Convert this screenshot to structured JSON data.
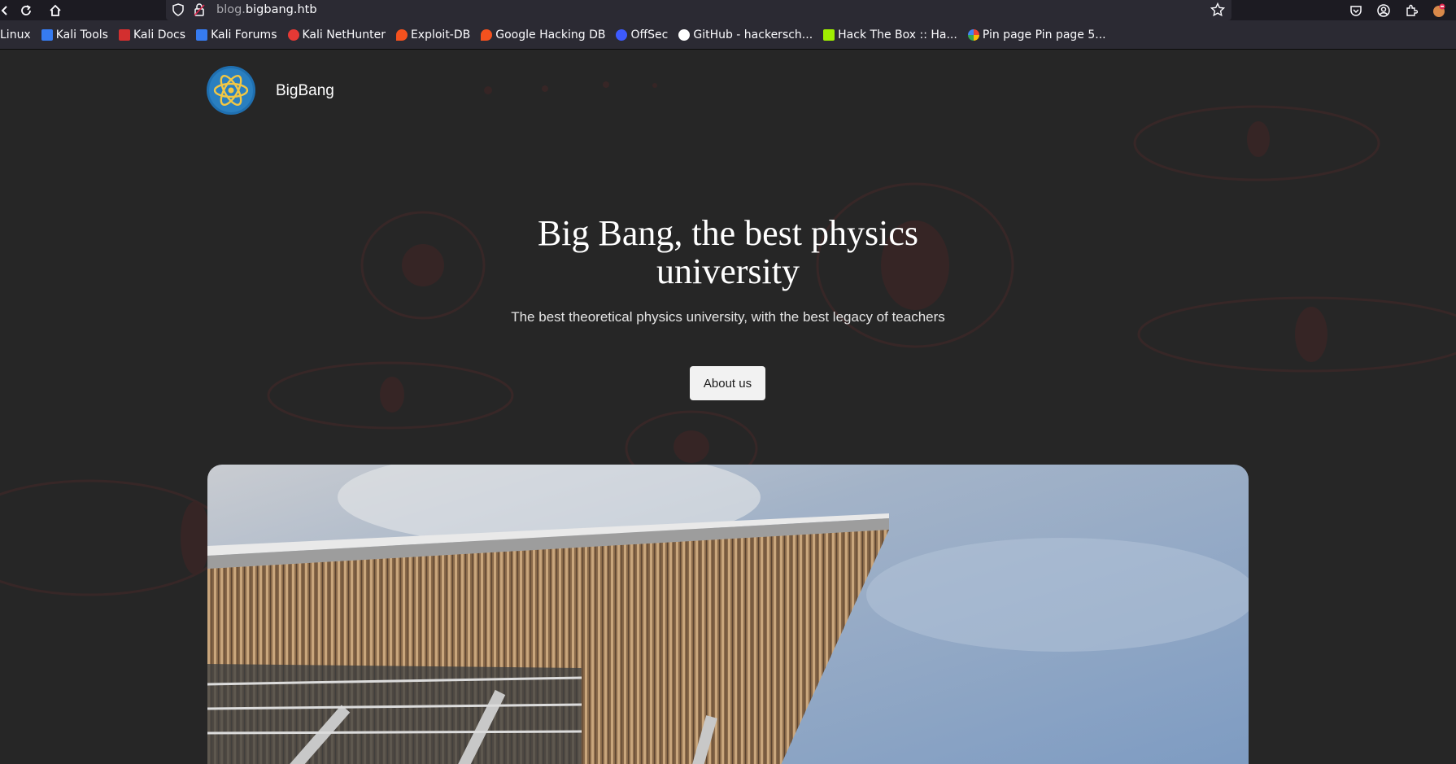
{
  "browser": {
    "url_subdomain": "blog.",
    "url_domain": "bigbang.htb",
    "bookmarks": [
      {
        "label": "Linux",
        "icon": "none"
      },
      {
        "label": "Kali Tools",
        "icon": "kali-tools-icon",
        "color": "#367bf0"
      },
      {
        "label": "Kali Docs",
        "icon": "kali-docs-icon",
        "color": "#d32f2f"
      },
      {
        "label": "Kali Forums",
        "icon": "kali-forums-icon",
        "color": "#367bf0"
      },
      {
        "label": "Kali NetHunter",
        "icon": "kali-nethunter-icon",
        "color": "#e53935"
      },
      {
        "label": "Exploit-DB",
        "icon": "exploit-db-icon",
        "color": "#f4511e"
      },
      {
        "label": "Google Hacking DB",
        "icon": "ghdb-icon",
        "color": "#f4511e"
      },
      {
        "label": "OffSec",
        "icon": "offsec-icon",
        "color": "#3d5afe"
      },
      {
        "label": "GitHub - hackersch...",
        "icon": "github-icon",
        "color": "#ffffff"
      },
      {
        "label": "Hack The Box :: Ha...",
        "icon": "htb-icon",
        "color": "#9fef00"
      },
      {
        "label": "Pin page Pin page 5...",
        "icon": "google-icon",
        "color": "#4285f4"
      }
    ]
  },
  "site": {
    "name": "BigBang",
    "hero_title": "Big Bang, the best physics university",
    "hero_subtitle": "The best theoretical physics university, with the best legacy of teachers",
    "cta_label": "About us"
  },
  "colors": {
    "page_bg": "#262626",
    "accent_deco": "#3a2626",
    "logo_bg": "#1f6fb0",
    "logo_atom": "#f2c744"
  }
}
